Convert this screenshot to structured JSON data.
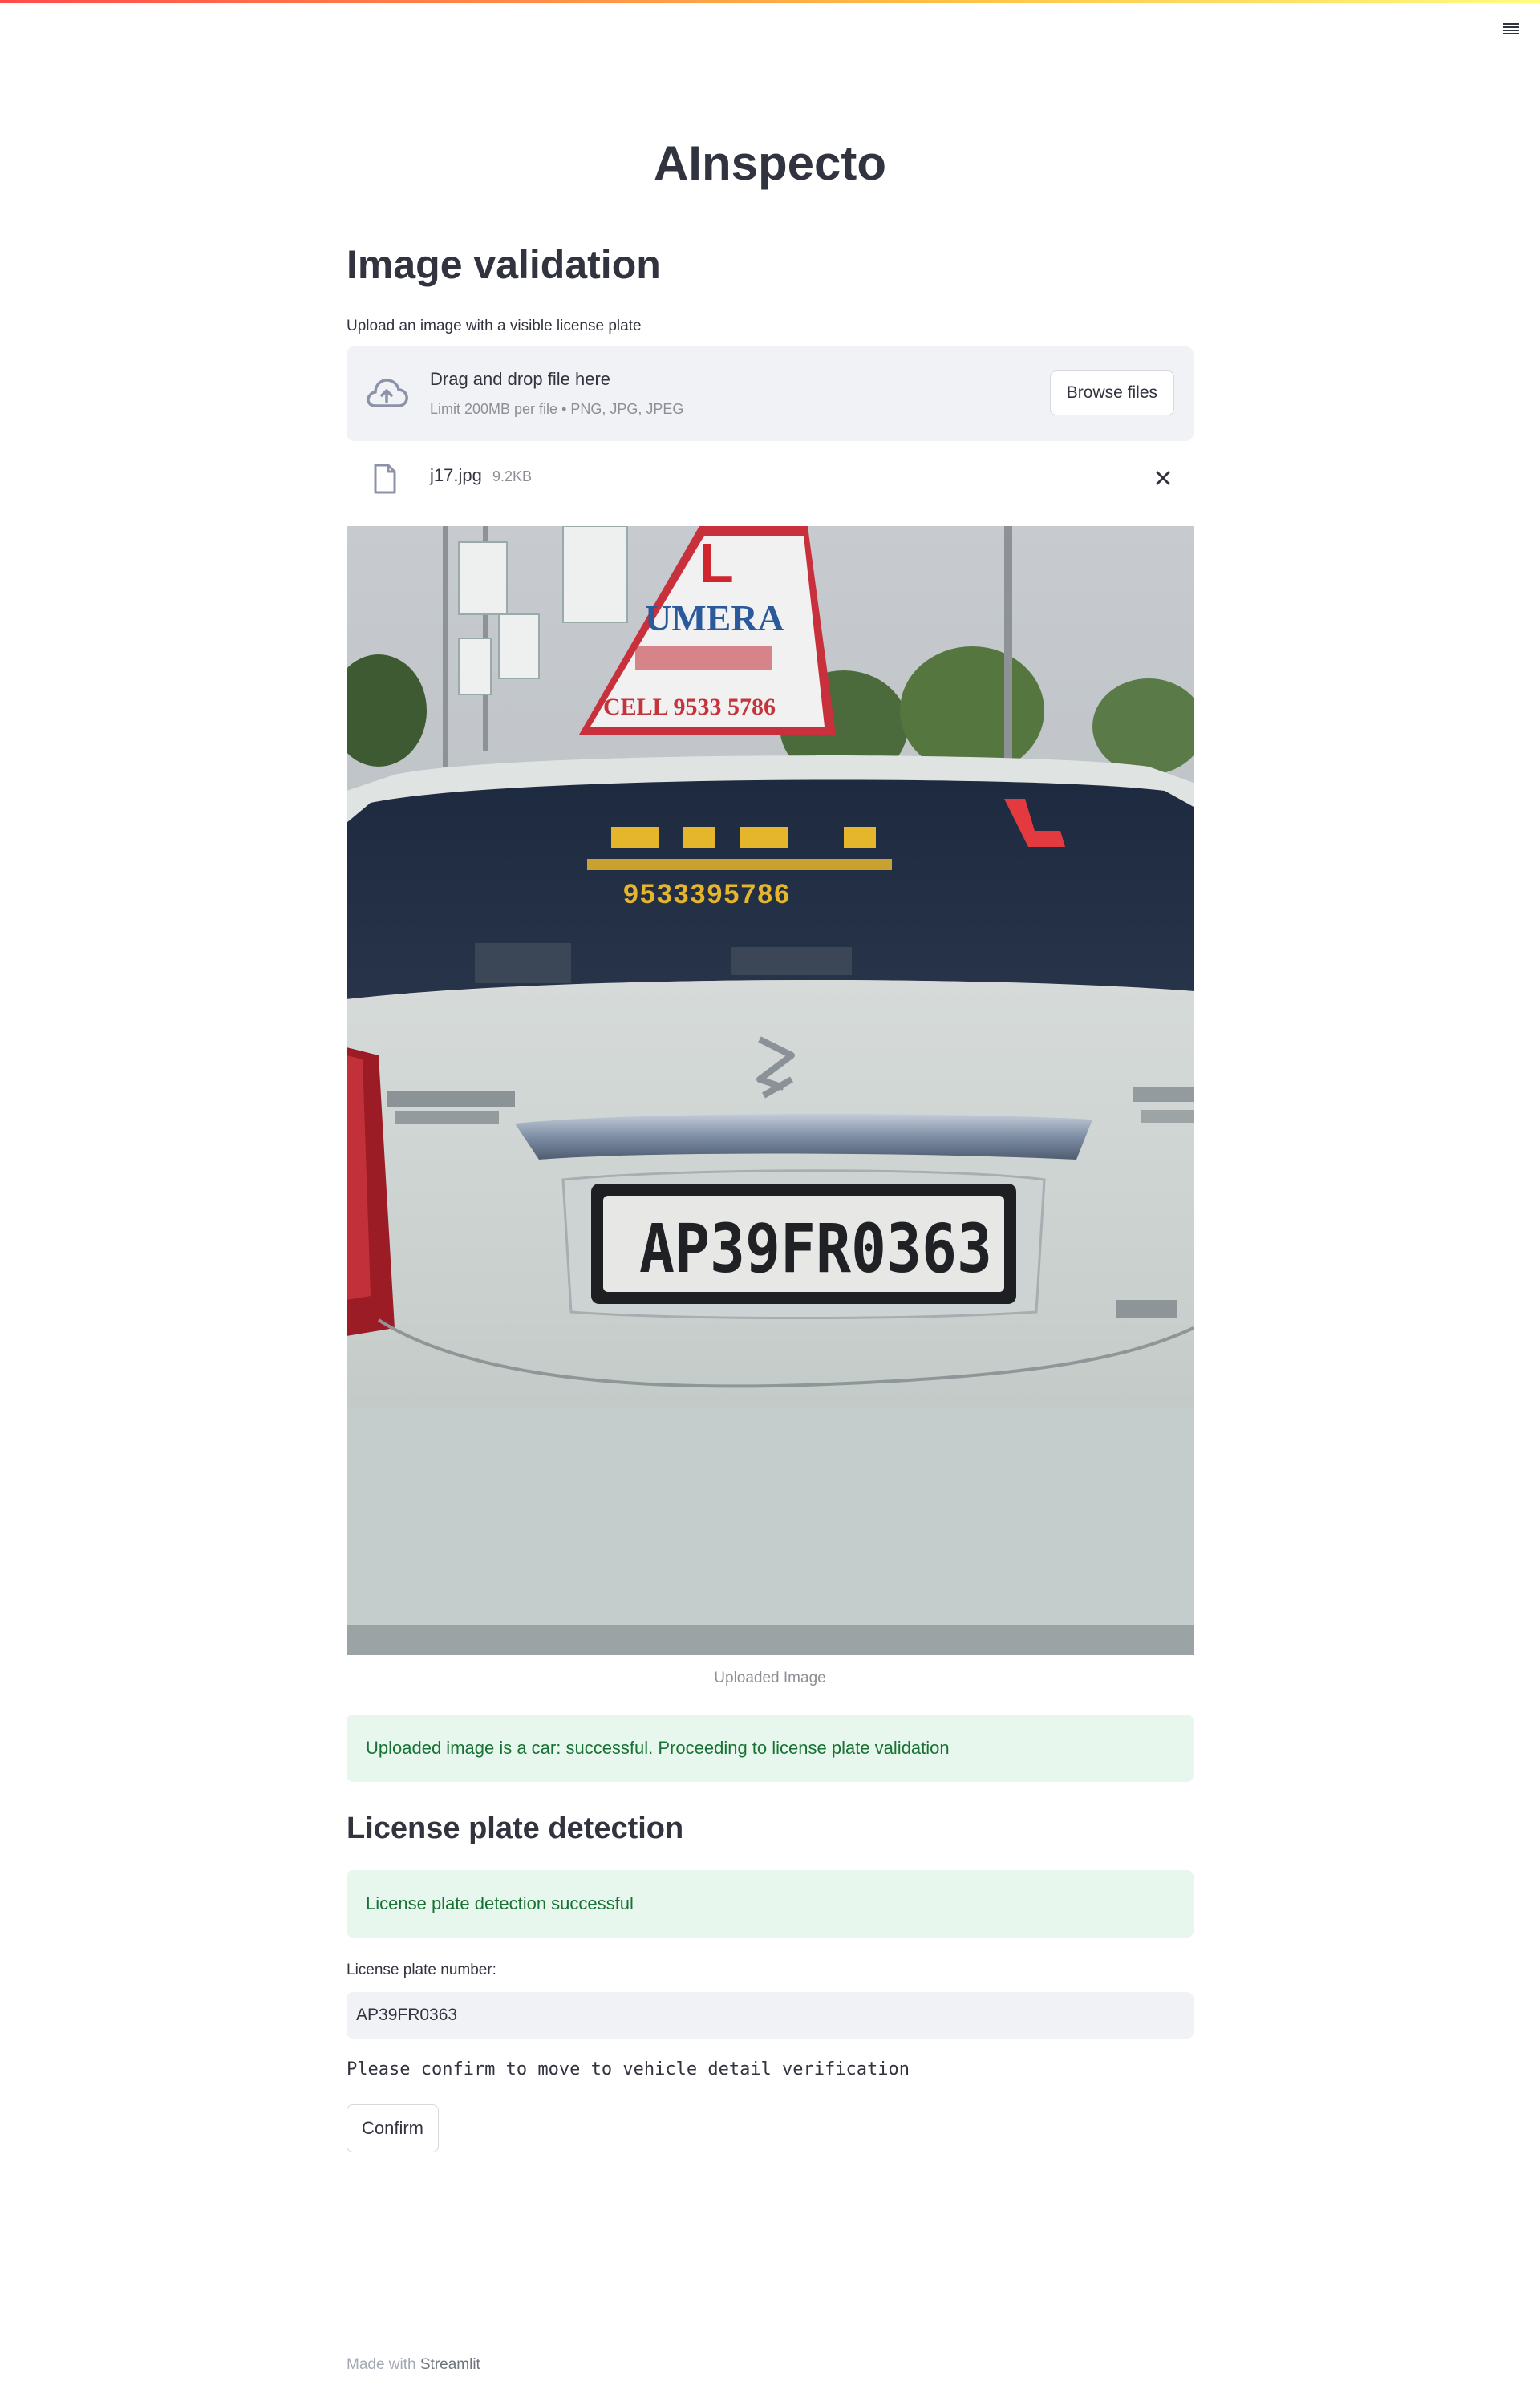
{
  "app": {
    "title": "AInspecto"
  },
  "image_validation": {
    "heading": "Image validation",
    "uploader_label": "Upload an image with a visible license plate",
    "dropzone_title": "Drag and drop file here",
    "dropzone_limit": "Limit 200MB per file • PNG, JPG, JPEG",
    "browse_label": "Browse files",
    "file": {
      "name": "j17.jpg",
      "size": "9.2KB"
    },
    "image": {
      "plate_text": "AP39FR0363",
      "sign_letter": "L",
      "sign_name": "UMERA",
      "sign_phone": "CELL 9533 5786",
      "window_phone": "9533395786"
    },
    "image_caption": "Uploaded Image",
    "success_message": "Uploaded image is a car: successful. Proceeding to license plate validation"
  },
  "plate_detection": {
    "heading": "License plate detection",
    "success_message": "License plate detection successful",
    "input_label": "License plate number:",
    "input_value": "AP39FR0363",
    "confirm_text": "Please confirm to move to vehicle detail verification",
    "confirm_label": "Confirm"
  },
  "footer": {
    "made_with": "Made with ",
    "brand": "Streamlit"
  },
  "icons": {
    "menu": "hamburger-menu-icon",
    "upload": "cloud-upload-icon",
    "file": "file-icon",
    "close": "close-icon"
  },
  "colors": {
    "success_bg": "#e8f7ed",
    "success_text": "#177233",
    "input_bg": "#f0f2f6",
    "text": "#31333f"
  }
}
